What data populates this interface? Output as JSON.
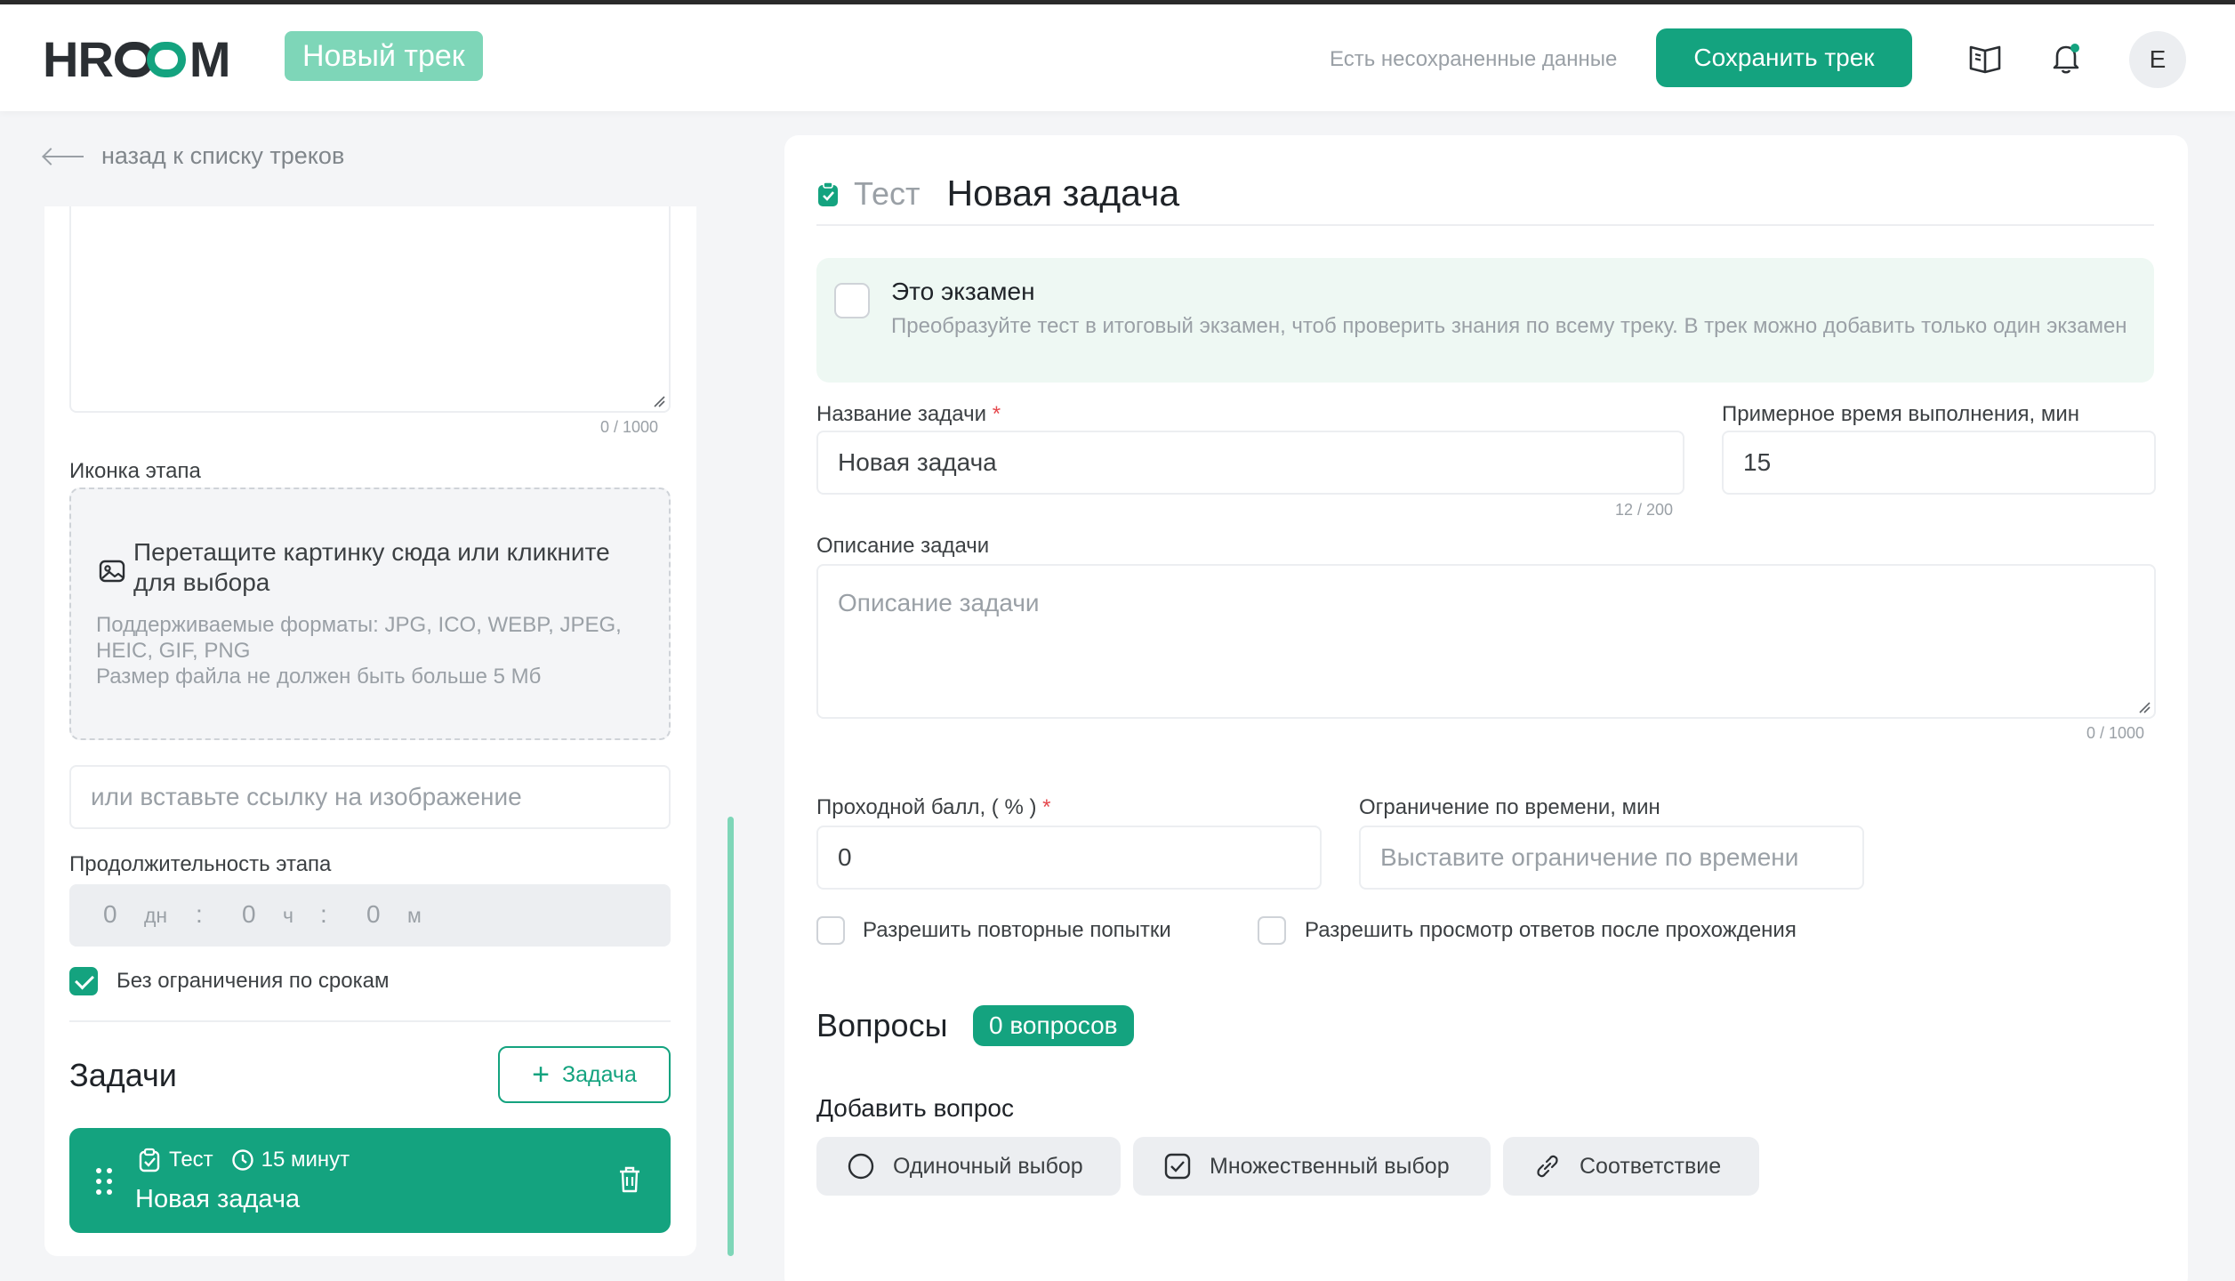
{
  "header": {
    "logo_text": "HROOM",
    "logo_left": "HR",
    "logo_right": "M",
    "badge": "Новый трек",
    "unsaved_text": "Есть несохраненные данные",
    "save_button": "Сохранить трек",
    "avatar_letter": "E"
  },
  "nav": {
    "back_label": "назад к списку треков"
  },
  "stage": {
    "description_counter": "0 / 1000",
    "icon_label": "Иконка этапа",
    "dropzone_main": "Перетащите картинку сюда или кликните для выбора",
    "dropzone_formats": "Поддерживаемые форматы: JPG, ICO, WEBP, JPEG, HEIC, GIF, PNG",
    "dropzone_size": "Размер файла не должен быть больше 5 Мб",
    "image_url_placeholder": "или вставьте ссылку на изображение",
    "duration_label": "Продолжительность этапа",
    "duration": {
      "days": "0",
      "days_unit": "дн",
      "hours": "0",
      "hours_unit": "ч",
      "minutes": "0",
      "minutes_unit": "м",
      "sep": ":"
    },
    "no_deadline_label": "Без ограничения по срокам",
    "no_deadline_checked": true
  },
  "tasks": {
    "title": "Задачи",
    "add_button": "Задача",
    "items": [
      {
        "type": "Тест",
        "duration": "15 минут",
        "name": "Новая задача"
      }
    ]
  },
  "editor": {
    "type_label": "Тест",
    "title": "Новая задача",
    "exam": {
      "title": "Это экзамен",
      "description": "Преобразуйте тест в итоговый экзамен, чтоб проверить знания по всему треку. В трек можно добавить только один экзамен",
      "checked": false
    },
    "task_name_label": "Название задачи",
    "task_name_value": "Новая задача",
    "task_name_counter": "12 / 200",
    "time_label": "Примерное время выполнения, мин",
    "time_value": "15",
    "description_label": "Описание задачи",
    "description_placeholder": "Описание задачи",
    "description_counter": "0 / 1000",
    "pass_score_label": "Проходной балл, ( % )",
    "pass_score_value": "0",
    "time_limit_label": "Ограничение по времени, мин",
    "time_limit_placeholder": "Выставите ограничение по времени",
    "allow_retry_label": "Разрешить повторные попытки",
    "allow_view_answers_label": "Разрешить просмотр ответов после прохождения",
    "required_mark": "*"
  },
  "questions": {
    "title": "Вопросы",
    "count_badge": "0 вопросов",
    "add_label": "Добавить вопрос",
    "types": [
      "Одиночный выбор",
      "Множественный выбор",
      "Соответствие"
    ]
  },
  "colors": {
    "accent": "#14a37f",
    "accent_light": "#7ed6b8",
    "exam_bg": "#eef8f3"
  }
}
